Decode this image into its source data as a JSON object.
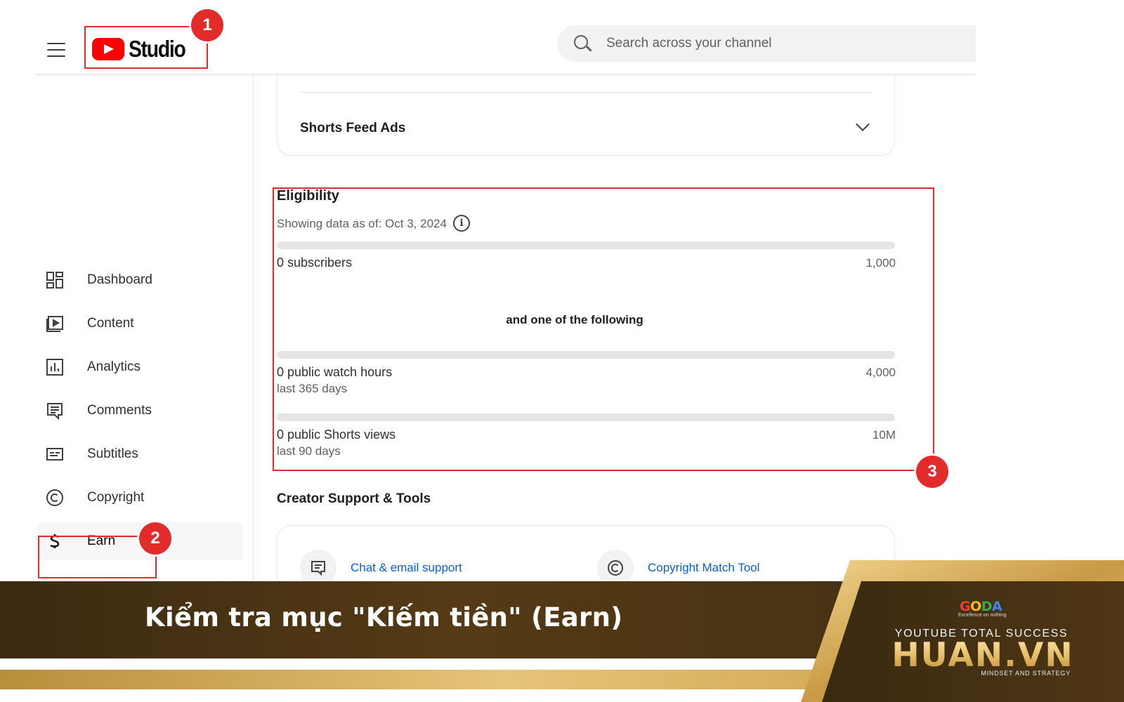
{
  "header": {
    "logo_text": "Studio",
    "search_placeholder": "Search across your channel"
  },
  "sidebar": {
    "items": [
      {
        "label": "Dashboard",
        "icon": "dashboard-icon"
      },
      {
        "label": "Content",
        "icon": "content-icon"
      },
      {
        "label": "Analytics",
        "icon": "analytics-icon"
      },
      {
        "label": "Comments",
        "icon": "comments-icon"
      },
      {
        "label": "Subtitles",
        "icon": "subtitles-icon"
      },
      {
        "label": "Copyright",
        "icon": "copyright-icon"
      },
      {
        "label": "Earn",
        "icon": "dollar-icon"
      }
    ],
    "active": "Earn"
  },
  "main": {
    "shorts_feed_ads": "Shorts Feed Ads",
    "eligibility": {
      "title": "Eligibility",
      "date_text": "Showing data as of: Oct 3, 2024",
      "info_glyph": "i",
      "following_text": "and one of the following",
      "metrics": [
        {
          "label": "0 subscribers",
          "sub": "",
          "target": "1,000",
          "progress": 0
        },
        {
          "label": "0 public watch hours",
          "sub": "last 365 days",
          "target": "4,000",
          "progress": 0
        },
        {
          "label": "0 public Shorts views",
          "sub": "last 90 days",
          "target": "10M",
          "progress": 0
        }
      ]
    },
    "creator_support": {
      "title": "Creator Support & Tools",
      "tools": [
        {
          "label": "Chat & email support",
          "icon": "chat-support-icon"
        },
        {
          "label": "Copyright Match Tool",
          "icon": "copyright-match-icon"
        }
      ]
    }
  },
  "annotations": {
    "badges": [
      "1",
      "2",
      "3"
    ],
    "color": "#e32b2b"
  },
  "banner": {
    "caption": "Kiểm tra mục \"Kiếm tiền\" (Earn)",
    "goda_logo": "GODA",
    "goda_tagline": "Excellence on nothing",
    "tagline": "YOUTUBE TOTAL SUCCESS",
    "brand": "HUAN.VN",
    "brand_sub": "MINDSET AND STRATEGY"
  },
  "colors": {
    "youtube_red": "#ff0000",
    "link_blue": "#065fd4",
    "banner_dark": "#4a3414",
    "banner_gold": "#e6c47a"
  }
}
